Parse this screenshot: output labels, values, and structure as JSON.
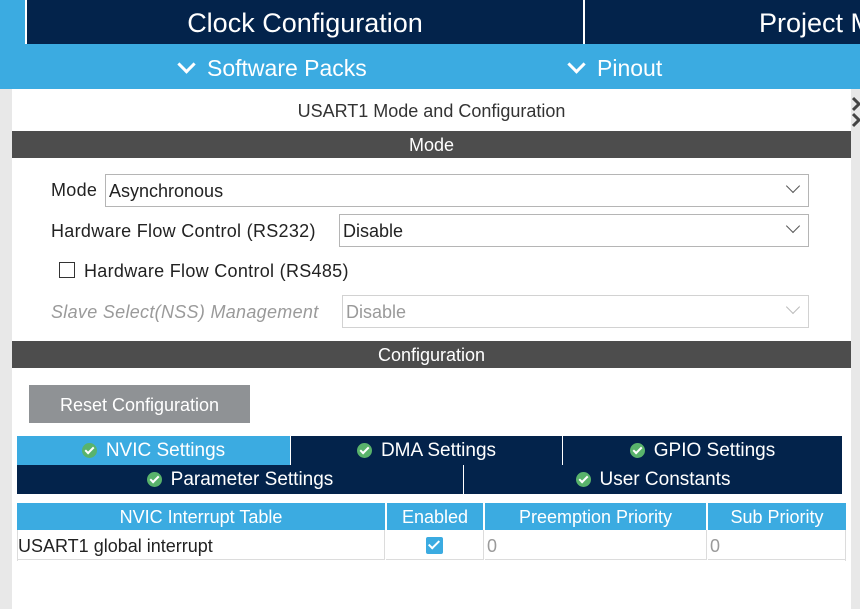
{
  "top_tabs": [
    {
      "label": "Clock Configuration"
    },
    {
      "label": "Project M"
    }
  ],
  "sub_nav": [
    {
      "label": "Software Packs",
      "icon": "chevron-down-icon"
    },
    {
      "label": "Pinout",
      "icon": "chevron-down-icon"
    }
  ],
  "panel": {
    "title": "USART1 Mode and Configuration"
  },
  "mode_section": {
    "header": "Mode",
    "mode_label": "Mode",
    "mode_value": "Asynchronous",
    "hw_flow_rs232_label": "Hardware Flow Control (RS232)",
    "hw_flow_rs232_value": "Disable",
    "hw_flow_rs485_label": "Hardware Flow Control (RS485)",
    "hw_flow_rs485_checked": false,
    "nss_label": "Slave Select(NSS) Management",
    "nss_value": "Disable"
  },
  "config_section": {
    "header": "Configuration",
    "reset_button": "Reset Configuration",
    "tabs_row1": [
      "NVIC Settings",
      "DMA Settings",
      "GPIO Settings"
    ],
    "tabs_row2": [
      "Parameter Settings",
      "User Constants"
    ],
    "active_tab": "NVIC Settings"
  },
  "nvic_table": {
    "headers": [
      "NVIC Interrupt Table",
      "Enabled",
      "Preemption Priority",
      "Sub Priority"
    ],
    "rows": [
      {
        "name": "USART1 global interrupt",
        "enabled": true,
        "preemption": "0",
        "sub": "0"
      }
    ]
  },
  "colors": {
    "dark_navy": "#03234b",
    "accent_blue": "#3babe1",
    "section_gray": "#4d4d4d",
    "ok_green": "#59b36b"
  }
}
